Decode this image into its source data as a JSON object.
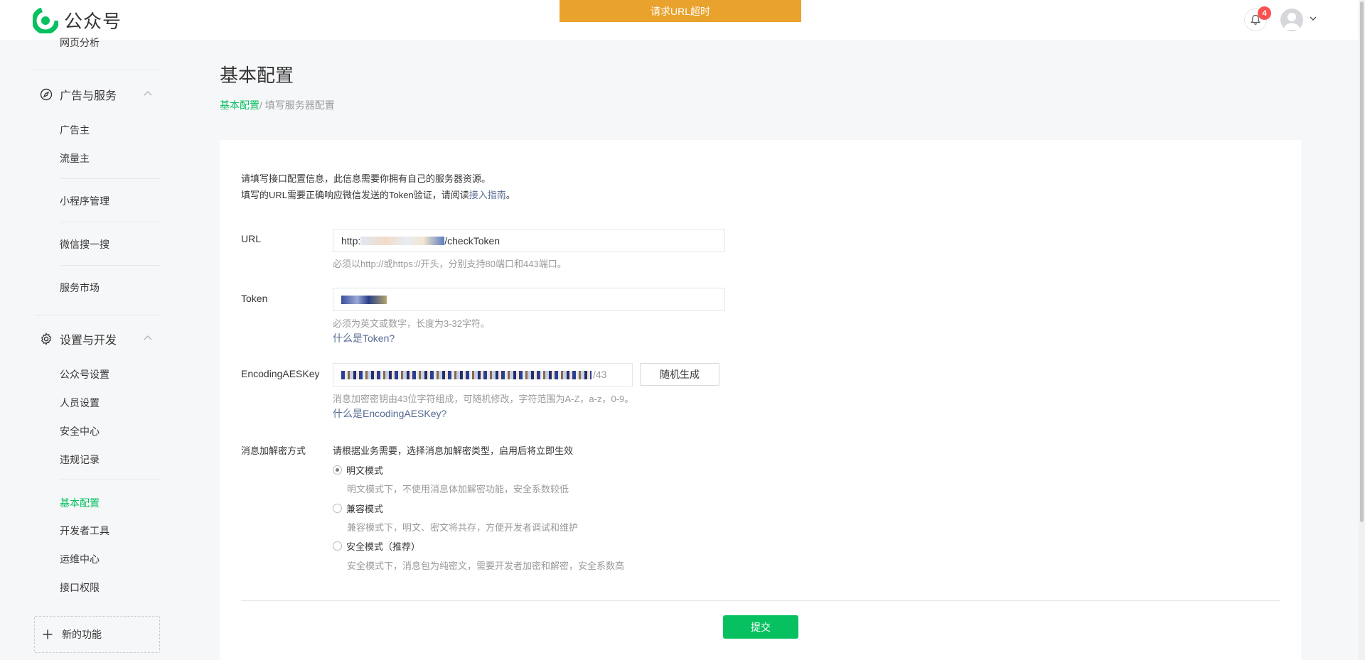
{
  "topbar": {
    "brand": "公众号",
    "alert": "请求URL超时",
    "notification_count": "4"
  },
  "sidebar": {
    "partial_top_item": "网页分析",
    "group_ads": {
      "label": "广告与服务",
      "items": [
        "广告主",
        "流量主"
      ]
    },
    "miniprogram": "小程序管理",
    "search": "微信搜一搜",
    "market": "服务市场",
    "group_dev": {
      "label": "设置与开发",
      "items": [
        "公众号设置",
        "人员设置",
        "安全中心",
        "违规记录",
        "基本配置",
        "开发者工具",
        "运维中心",
        "接口权限"
      ]
    },
    "new_feature": "新的功能"
  },
  "main": {
    "title": "基本配置",
    "breadcrumb_link": "基本配置",
    "breadcrumb_current": "/ 填写服务器配置",
    "intro_line1": "请填写接口配置信息，此信息需要你拥有自己的服务器资源。",
    "intro_line2_prefix": "填写的URL需要正确响应微信发送的Token验证，请阅读",
    "intro_line2_link": "接入指南",
    "intro_line2_suffix": "。",
    "url": {
      "label": "URL",
      "value_prefix": "http:",
      "value_suffix": "/checkToken",
      "hint": "必须以http://或https://开头，分别支持80端口和443端口。"
    },
    "token": {
      "label": "Token",
      "hint": "必须为英文或数字，长度为3-32字符。",
      "help_link": "什么是Token?"
    },
    "aeskey": {
      "label": "EncodingAESKey",
      "counter": "/43",
      "generate_button": "随机生成",
      "hint": "消息加密密钥由43位字符组成，可随机修改，字符范围为A-Z，a-z，0-9。",
      "help_link": "什么是EncodingAESKey?"
    },
    "encryption": {
      "label": "消息加解密方式",
      "description": "请根据业务需要，选择消息加解密类型，启用后将立即生效",
      "options": [
        {
          "label": "明文模式",
          "desc": "明文模式下，不使用消息体加解密功能，安全系数较低",
          "checked": true
        },
        {
          "label": "兼容模式",
          "desc": "兼容模式下，明文、密文将共存，方便开发者调试和维护",
          "checked": false
        },
        {
          "label": "安全模式（推荐）",
          "desc": "安全模式下，消息包为纯密文，需要开发者加密和解密，安全系数高",
          "checked": false
        }
      ]
    },
    "submit_button": "提交"
  },
  "colors": {
    "accent": "#07c160",
    "alert": "#e9a22d",
    "link": "#576b95",
    "badge": "#fa5151"
  }
}
